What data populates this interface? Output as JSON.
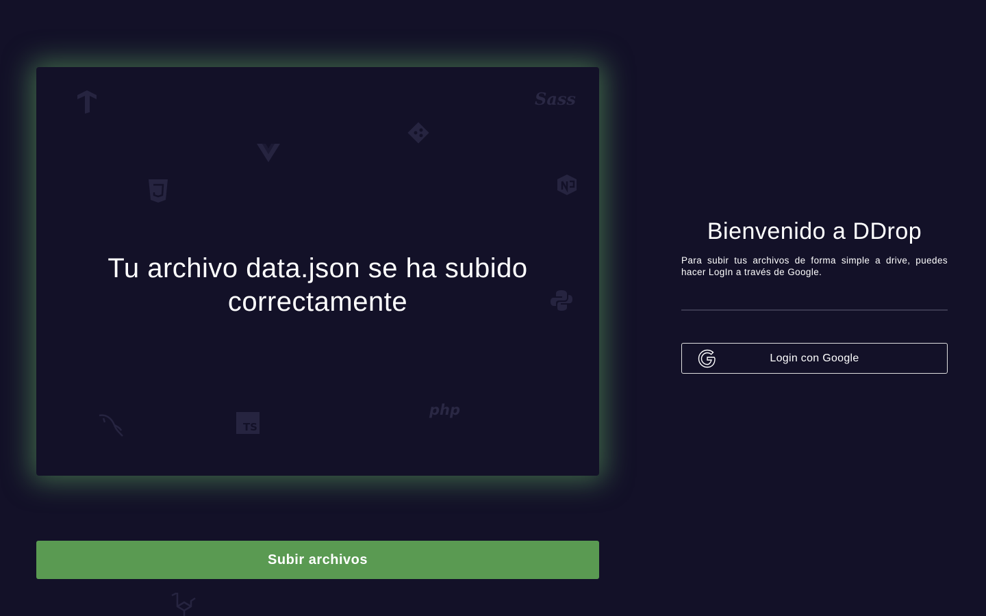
{
  "drop_area": {
    "message": "Tu archivo data.json se ha subido correctamente",
    "background_icons": [
      "tensorflow-icon",
      "sass-icon",
      "git-icon",
      "vue-icon",
      "css3-icon",
      "npm-icon",
      "python-icon",
      "mysql-icon",
      "typescript-icon",
      "php-icon",
      "laravel-icon"
    ],
    "glow_color": "#60aa60"
  },
  "upload_button": {
    "label": "Subir archivos",
    "color": "#5a9a52"
  },
  "side_panel": {
    "title": "Bienvenido a DDrop",
    "description": "Para subir tus archivos de forma simple a drive, puedes hacer LogIn a través de Google.",
    "login_label": "Login con Google",
    "login_icon": "google-icon"
  },
  "bg_text": {
    "sass": "Sass",
    "ts": "TS",
    "php": "php"
  },
  "colors": {
    "background": "#131128",
    "text": "#ffffff"
  }
}
